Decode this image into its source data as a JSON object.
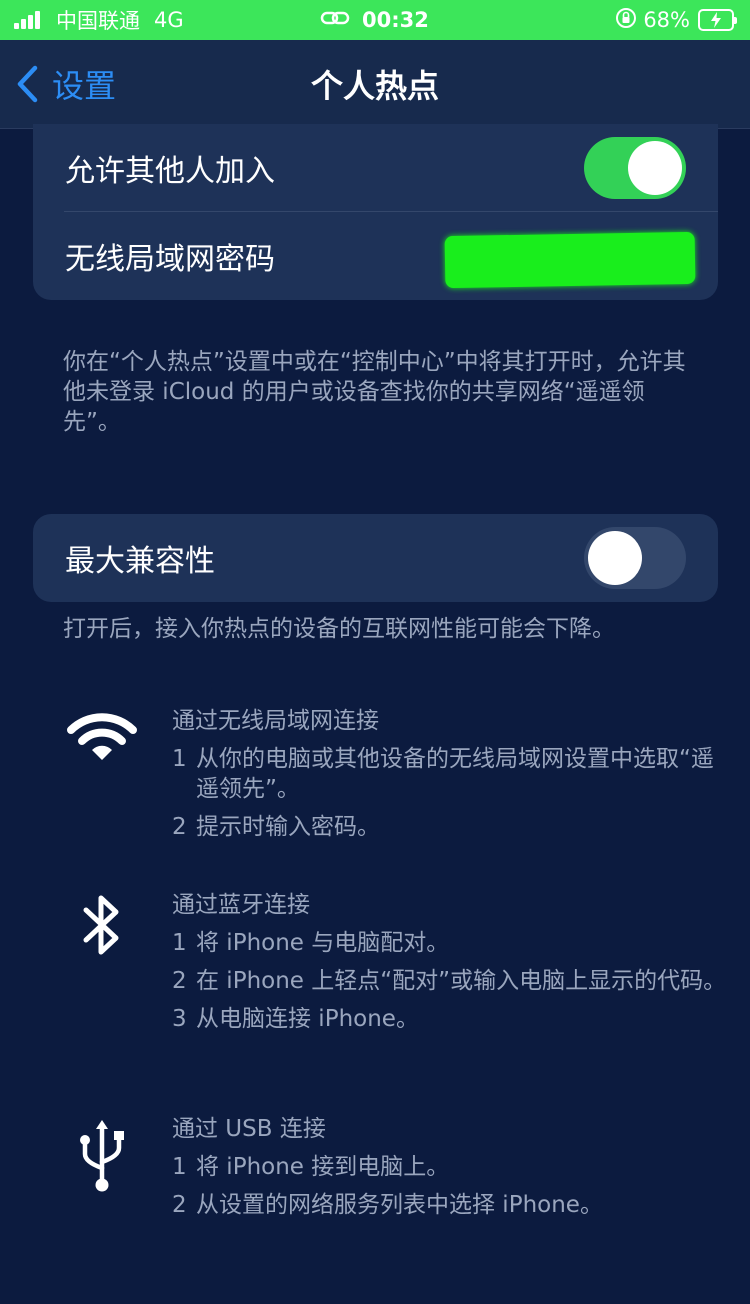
{
  "status_bar": {
    "carrier": "中国联通",
    "network": "4G",
    "time": "00:32",
    "battery_percent": "68%",
    "icons": [
      "signal-icon",
      "hotspot-link-icon",
      "orientation-lock-icon",
      "battery-charging-icon"
    ]
  },
  "nav": {
    "back_label": "设置",
    "title": "个人热点"
  },
  "group1": {
    "allow_others_label": "允许其他人加入",
    "allow_others_on": true,
    "wifi_password_label": "无线局域网密码"
  },
  "footer1": "你在“个人热点”设置中或在“控制中心”中将其打开时，允许其他未登录 iCloud 的用户或设备查找你的共享网络“遥遥领先”。",
  "group2": {
    "max_compat_label": "最大兼容性",
    "max_compat_on": false
  },
  "footer2": "打开后，接入你热点的设备的互联网性能可能会下降。",
  "methods": [
    {
      "icon": "wifi-icon",
      "title": "通过无线局域网连接",
      "steps": [
        {
          "num": "1",
          "text": "从你的电脑或其他设备的无线局域网设置中选取“遥遥领先”。"
        },
        {
          "num": "2",
          "text": "提示时输入密码。"
        }
      ]
    },
    {
      "icon": "bluetooth-icon",
      "title": "通过蓝牙连接",
      "steps": [
        {
          "num": "1",
          "text": "将 iPhone 与电脑配对。"
        },
        {
          "num": "2",
          "text": "在 iPhone 上轻点“配对”或输入电脑上显示的代码。"
        },
        {
          "num": "3",
          "text": "从电脑连接 iPhone。"
        }
      ]
    },
    {
      "icon": "usb-icon",
      "title": "通过 USB 连接",
      "steps": [
        {
          "num": "1",
          "text": "将 iPhone 接到电脑上。"
        },
        {
          "num": "2",
          "text": "从设置的网络服务列表中选择 iPhone。"
        }
      ]
    }
  ],
  "colors": {
    "accent": "#2c8df5",
    "toggle_on": "#33d157",
    "status_bar": "#3ce65a",
    "background": "#0c1b3f"
  }
}
